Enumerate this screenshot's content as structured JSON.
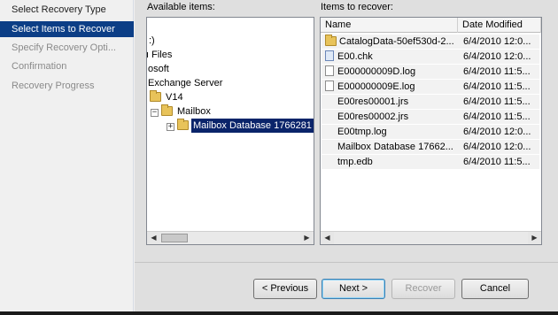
{
  "steps": [
    {
      "label": "Select Recovery Type",
      "state": "done"
    },
    {
      "label": "Select Items to Recover",
      "state": "active"
    },
    {
      "label": "Specify Recovery Opti...",
      "state": "pending"
    },
    {
      "label": "Confirmation",
      "state": "pending"
    },
    {
      "label": "Recovery Progress",
      "state": "pending"
    }
  ],
  "available": {
    "label": "Available items:",
    "tree": [
      {
        "label": ":)",
        "icon": "none"
      },
      {
        "label": "ı Files",
        "icon": "none"
      },
      {
        "label": "osoft",
        "icon": "none"
      },
      {
        "label": "Exchange Server",
        "icon": "none"
      },
      {
        "label": "V14",
        "icon": "folder-icon"
      },
      {
        "label": "Mailbox",
        "icon": "folder-icon",
        "expander": "−"
      },
      {
        "label": "Mailbox Database 1766281",
        "icon": "folder-icon",
        "expander": "+",
        "selected": true
      }
    ]
  },
  "recover": {
    "label": "Items to recover:",
    "columns": [
      "Name",
      "Date Modified"
    ],
    "rows": [
      {
        "name": "CatalogData-50ef530d-2...",
        "date": "6/4/2010 12:0...",
        "icon": "folder-icon"
      },
      {
        "name": "E00.chk",
        "date": "6/4/2010 12:0...",
        "icon": "chk-file-icon"
      },
      {
        "name": "E000000009D.log",
        "date": "6/4/2010 11:5...",
        "icon": "file-icon"
      },
      {
        "name": "E000000009E.log",
        "date": "6/4/2010 11:5...",
        "icon": "file-icon"
      },
      {
        "name": "E00res00001.jrs",
        "date": "6/4/2010 11:5...",
        "icon": "none"
      },
      {
        "name": "E00res00002.jrs",
        "date": "6/4/2010 11:5...",
        "icon": "none"
      },
      {
        "name": "E00tmp.log",
        "date": "6/4/2010 12:0...",
        "icon": "none"
      },
      {
        "name": "Mailbox Database 17662...",
        "date": "6/4/2010 12:0...",
        "icon": "none"
      },
      {
        "name": "tmp.edb",
        "date": "6/4/2010 11:5...",
        "icon": "none"
      }
    ]
  },
  "buttons": {
    "previous": "< Previous",
    "next": "Next >",
    "recover": "Recover",
    "cancel": "Cancel"
  },
  "scroll": {
    "left_arrow": "◀",
    "right_arrow": "▶"
  },
  "colors": {
    "active_step": "#0c3e86",
    "selection": "#0a246a"
  }
}
